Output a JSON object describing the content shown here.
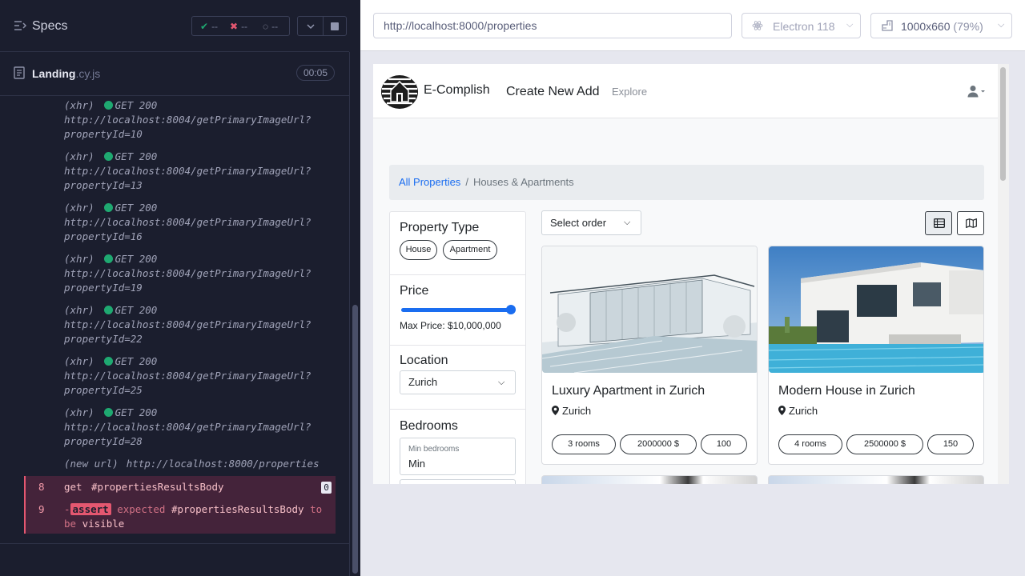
{
  "runner": {
    "specs_title": "Specs",
    "stats": {
      "passed": "--",
      "failed": "--",
      "pending": "--"
    },
    "spec": {
      "name": "Landing",
      "ext": ".cy.js",
      "duration": "00:05"
    },
    "log": [
      {
        "kind": "(xhr)",
        "method": "GET 200",
        "url": "http://localhost:8004/getPrimaryImageUrl?",
        "query": "propertyId=10"
      },
      {
        "kind": "(xhr)",
        "method": "GET 200",
        "url": "http://localhost:8004/getPrimaryImageUrl?",
        "query": "propertyId=13"
      },
      {
        "kind": "(xhr)",
        "method": "GET 200",
        "url": "http://localhost:8004/getPrimaryImageUrl?",
        "query": "propertyId=16"
      },
      {
        "kind": "(xhr)",
        "method": "GET 200",
        "url": "http://localhost:8004/getPrimaryImageUrl?",
        "query": "propertyId=19"
      },
      {
        "kind": "(xhr)",
        "method": "GET 200",
        "url": "http://localhost:8004/getPrimaryImageUrl?",
        "query": "propertyId=22"
      },
      {
        "kind": "(xhr)",
        "method": "GET 200",
        "url": "http://localhost:8004/getPrimaryImageUrl?",
        "query": "propertyId=25"
      },
      {
        "kind": "(xhr)",
        "method": "GET 200",
        "url": "http://localhost:8004/getPrimaryImageUrl?",
        "query": "propertyId=28"
      }
    ],
    "new_url": {
      "kind": "(new url)",
      "value": "http://localhost:8000/properties"
    },
    "commands": [
      {
        "num": "8",
        "name": "get",
        "selector": "#propertiesResultsBody",
        "count": "0"
      },
      {
        "num": "9",
        "prefix": "-",
        "name": "assert",
        "text_a": "expected",
        "selector": "#propertiesResultsBody",
        "text_b": "to",
        "text_c": "be",
        "text_d": "visible"
      }
    ],
    "colors": {
      "bg": "#1b1e2e",
      "pass": "#1fa971",
      "fail": "#e45770"
    }
  },
  "toolbar": {
    "url": "http://localhost:8000/properties",
    "browser": "Electron 118",
    "viewport": "1000x660",
    "zoom": "(79%)"
  },
  "app": {
    "brand": "E-Complish",
    "nav": {
      "create": "Create New Add",
      "explore": "Explore"
    },
    "breadcrumb": {
      "all": "All Properties",
      "sep": "/",
      "current": "Houses & Apartments"
    },
    "filters": {
      "type_title": "Property Type",
      "type_options": [
        "House",
        "Apartment"
      ],
      "price_title": "Price",
      "price_max_label": "Max Price: $10,000,000",
      "price_fraction": 1.0,
      "location_title": "Location",
      "location_value": "Zurich",
      "bedrooms_title": "Bedrooms",
      "min_bedrooms_label": "Min bedrooms",
      "min_bedrooms_value": "Min"
    },
    "order_placeholder": "Select order",
    "cards": [
      {
        "title": "Luxury Apartment in Zurich",
        "location": "Zurich",
        "rooms": "3 rooms",
        "price": "2000000 $",
        "size": "100"
      },
      {
        "title": "Modern House in Zurich",
        "location": "Zurich",
        "rooms": "4 rooms",
        "price": "2500000 $",
        "size": "150"
      }
    ],
    "colors": {
      "primary": "#1a6df0"
    }
  }
}
